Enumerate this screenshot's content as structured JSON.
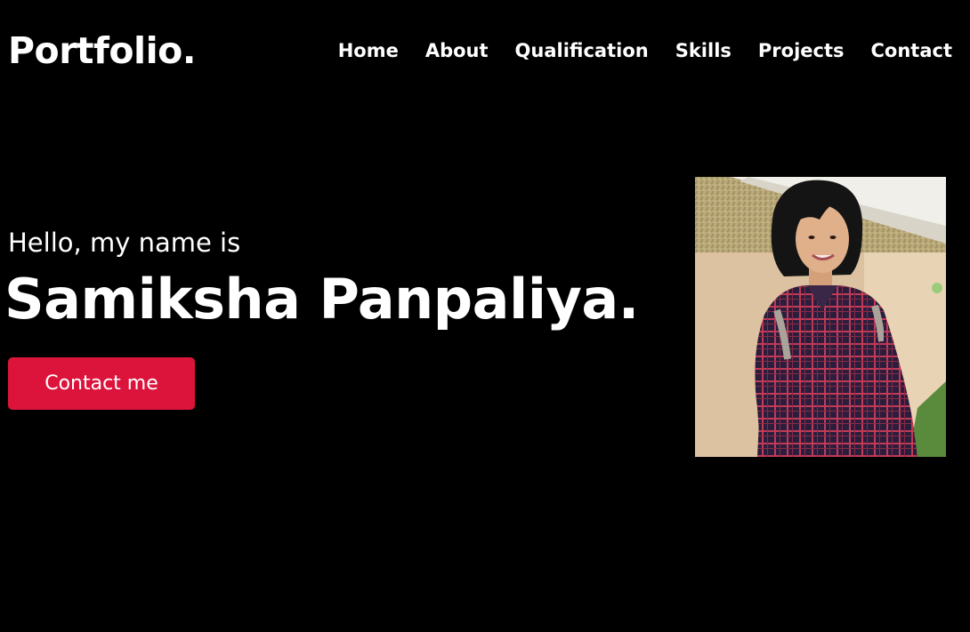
{
  "header": {
    "logo": "Portfolio.",
    "nav": [
      {
        "label": "Home"
      },
      {
        "label": "About"
      },
      {
        "label": "Qualification"
      },
      {
        "label": "Skills"
      },
      {
        "label": "Projects"
      },
      {
        "label": "Contact"
      }
    ]
  },
  "hero": {
    "greeting": "Hello, my name is",
    "name": "Samiksha Panpaliya.",
    "cta_label": "Contact me",
    "photo_icon": "profile-photo"
  },
  "colors": {
    "background": "#000000",
    "text": "#ffffff",
    "accent": "#dc143c"
  }
}
